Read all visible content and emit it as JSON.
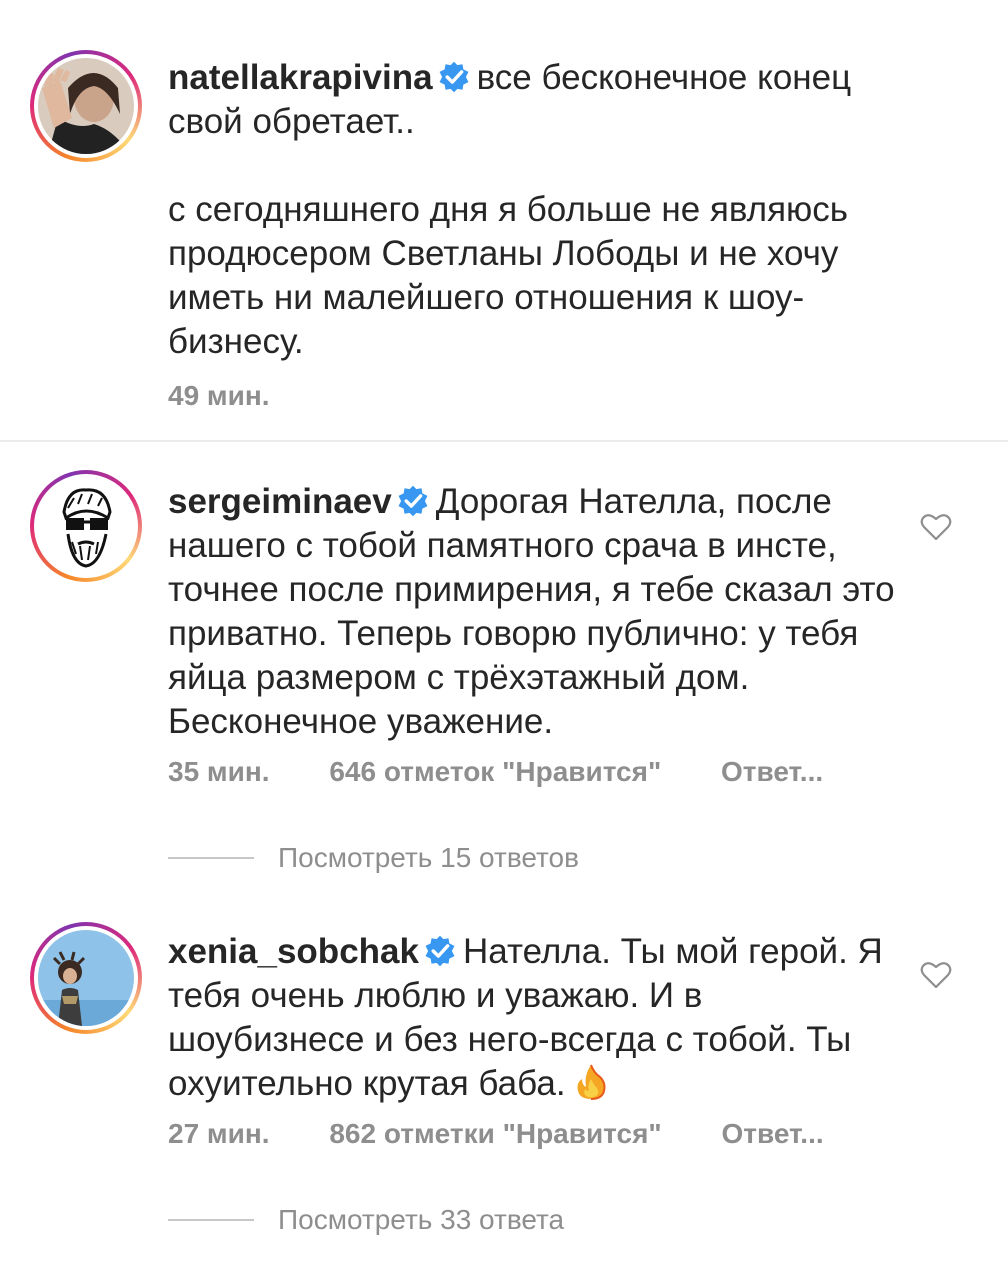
{
  "comments": [
    {
      "username": "natellakrapivina",
      "verified": true,
      "text_first": "все бесконечное конец свой обретает..",
      "text_rest": "с сегодняшнего дня я больше не являюсь продюсером Светланы Лободы и не хочу иметь ни малейшего отношения к шоу-бизнесу.",
      "time": "49 мин."
    },
    {
      "username": "sergeiminaev",
      "verified": true,
      "text": "Дорогая Нателла, после нашего с тобой памятного срача в инсте, точнее после примирения, я тебе сказал это приватно. Теперь говорю публично: у тебя яйца размером с трёхэтажный дом. Бесконечное уважение.",
      "time": "35 мин.",
      "likes": "646 отметок \"Нравится\"",
      "reply": "Ответ...",
      "view_replies": "Посмотреть 15 ответов"
    },
    {
      "username": "xenia_sobchak",
      "verified": true,
      "text": "Нателла. Ты мой герой. Я тебя очень люблю и уважаю. И в шоубизнесе и без него-всегда с тобой. Ты охуительно крутая баба.",
      "emoji": "fire-icon",
      "time": "27 мин.",
      "likes": "862 отметки \"Нравится\"",
      "reply": "Ответ...",
      "view_replies": "Посмотреть 33 ответа"
    }
  ],
  "colors": {
    "text": "#262626",
    "muted": "#8e8e8e",
    "verified": "#3897f0",
    "divider": "#ececec"
  }
}
